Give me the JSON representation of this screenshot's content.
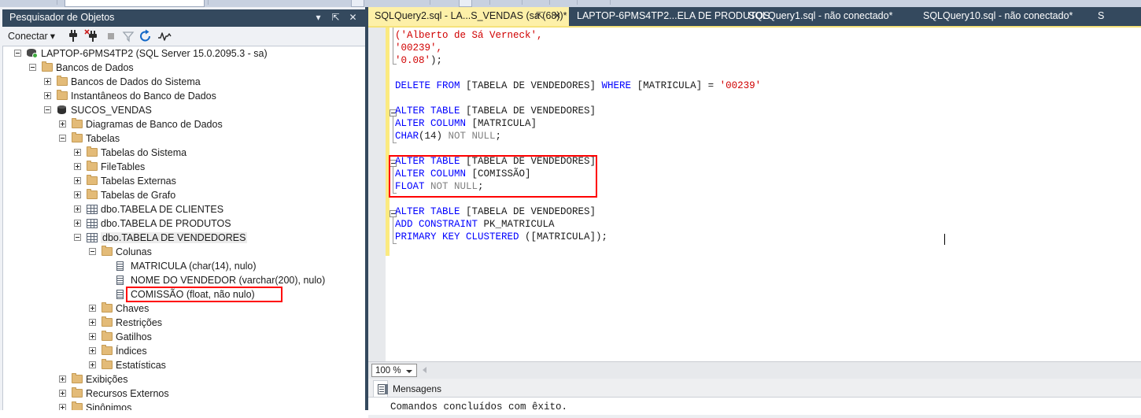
{
  "object_explorer": {
    "title": "Pesquisador de Objetos",
    "window_controls": {
      "dropdown": "▾",
      "pin": "⇱",
      "close": "✕"
    },
    "toolbar": {
      "connect_label": "Conectar",
      "connect_arrow": "▾",
      "icons": [
        "connect-plug-icon",
        "disconnect-plug-icon",
        "stop-icon",
        "filter-icon",
        "refresh-icon",
        "activity-monitor-icon"
      ]
    },
    "tree": [
      {
        "label": "LAPTOP-6PMS4TP2 (SQL Server 15.0.2095.3 - sa)",
        "depth": 0,
        "icon": "server-icon",
        "state": "expanded"
      },
      {
        "label": "Bancos de Dados",
        "depth": 1,
        "icon": "folder-icon",
        "state": "expanded"
      },
      {
        "label": "Bancos de Dados do Sistema",
        "depth": 2,
        "icon": "folder-icon",
        "state": "collapsed"
      },
      {
        "label": "Instantâneos do Banco de Dados",
        "depth": 2,
        "icon": "folder-icon",
        "state": "collapsed"
      },
      {
        "label": "SUCOS_VENDAS",
        "depth": 2,
        "icon": "database-icon",
        "state": "expanded"
      },
      {
        "label": "Diagramas de Banco de Dados",
        "depth": 3,
        "icon": "folder-icon",
        "state": "collapsed"
      },
      {
        "label": "Tabelas",
        "depth": 3,
        "icon": "folder-icon",
        "state": "expanded"
      },
      {
        "label": "Tabelas do Sistema",
        "depth": 4,
        "icon": "folder-icon",
        "state": "collapsed"
      },
      {
        "label": "FileTables",
        "depth": 4,
        "icon": "folder-icon",
        "state": "collapsed"
      },
      {
        "label": "Tabelas Externas",
        "depth": 4,
        "icon": "folder-icon",
        "state": "collapsed"
      },
      {
        "label": "Tabelas de Grafo",
        "depth": 4,
        "icon": "folder-icon",
        "state": "collapsed"
      },
      {
        "label": "dbo.TABELA DE CLIENTES",
        "depth": 4,
        "icon": "table-icon",
        "state": "collapsed"
      },
      {
        "label": "dbo.TABELA DE PRODUTOS",
        "depth": 4,
        "icon": "table-icon",
        "state": "collapsed"
      },
      {
        "label": "dbo.TABELA DE VENDEDORES",
        "depth": 4,
        "icon": "table-icon",
        "state": "expanded",
        "selected": true
      },
      {
        "label": "Colunas",
        "depth": 5,
        "icon": "folder-icon",
        "state": "expanded"
      },
      {
        "label": "MATRICULA (char(14), nulo)",
        "depth": 6,
        "icon": "column-icon",
        "state": "leaf"
      },
      {
        "label": "NOME DO VENDEDOR (varchar(200), nulo)",
        "depth": 6,
        "icon": "column-icon",
        "state": "leaf"
      },
      {
        "label": "COMISSÃO (float, não nulo)",
        "depth": 6,
        "icon": "column-icon",
        "state": "leaf",
        "highlighted": true
      },
      {
        "label": "Chaves",
        "depth": 5,
        "icon": "folder-icon",
        "state": "collapsed"
      },
      {
        "label": "Restrições",
        "depth": 5,
        "icon": "folder-icon",
        "state": "collapsed"
      },
      {
        "label": "Gatilhos",
        "depth": 5,
        "icon": "folder-icon",
        "state": "collapsed"
      },
      {
        "label": "Índices",
        "depth": 5,
        "icon": "folder-icon",
        "state": "collapsed"
      },
      {
        "label": "Estatísticas",
        "depth": 5,
        "icon": "folder-icon",
        "state": "collapsed"
      },
      {
        "label": "Exibições",
        "depth": 3,
        "icon": "folder-icon",
        "state": "collapsed"
      },
      {
        "label": "Recursos Externos",
        "depth": 3,
        "icon": "folder-icon",
        "state": "collapsed"
      },
      {
        "label": "Sinônimos",
        "depth": 3,
        "icon": "folder-icon",
        "state": "collapsed"
      }
    ]
  },
  "tabs": [
    {
      "label": "SQLQuery2.sql - LA...S_VENDAS (sa (68))*",
      "active": true,
      "pin": "⇱",
      "close": "✕"
    },
    {
      "label": "LAPTOP-6PMS4TP2...ELA DE PRODUTOS",
      "active": false
    },
    {
      "label": "SQLQuery1.sql - não conectado*",
      "active": false
    },
    {
      "label": "SQLQuery10.sql - não conectado*",
      "active": false
    },
    {
      "label": "S",
      "active": false
    }
  ],
  "code_lines": [
    [
      {
        "t": "('",
        "c": "str"
      },
      {
        "t": "Alberto de Sá Verneck",
        "c": "str"
      },
      {
        "t": "',",
        "c": "str"
      }
    ],
    [
      {
        "t": "'00239',",
        "c": "str"
      }
    ],
    [
      {
        "t": "'0.08'",
        "c": "str"
      },
      {
        "t": ");",
        "c": "plain"
      }
    ],
    [],
    [
      {
        "t": "DELETE FROM ",
        "c": "kw"
      },
      {
        "t": "[TABELA DE VENDEDORES] ",
        "c": "plain"
      },
      {
        "t": "WHERE ",
        "c": "kw"
      },
      {
        "t": "[MATRICULA] = ",
        "c": "plain"
      },
      {
        "t": "'00239'",
        "c": "str"
      }
    ],
    [],
    [
      {
        "t": "ALTER TABLE ",
        "c": "kw"
      },
      {
        "t": "[TABELA DE VENDEDORES]",
        "c": "plain"
      }
    ],
    [
      {
        "t": "ALTER COLUMN ",
        "c": "kw"
      },
      {
        "t": "[MATRICULA]",
        "c": "plain"
      }
    ],
    [
      {
        "t": "CHAR",
        "c": "kw"
      },
      {
        "t": "(14) ",
        "c": "plain"
      },
      {
        "t": "NOT NULL",
        "c": "gray"
      },
      {
        "t": ";",
        "c": "plain"
      }
    ],
    [],
    [
      {
        "t": "ALTER TABLE ",
        "c": "kw"
      },
      {
        "t": "[TABELA DE VENDEDORES]",
        "c": "plain"
      }
    ],
    [
      {
        "t": "ALTER COLUMN ",
        "c": "kw"
      },
      {
        "t": "[COMISSÃO]",
        "c": "plain"
      }
    ],
    [
      {
        "t": "FLOAT ",
        "c": "kw"
      },
      {
        "t": "NOT NULL",
        "c": "gray"
      },
      {
        "t": ";",
        "c": "plain"
      }
    ],
    [],
    [
      {
        "t": "ALTER TABLE ",
        "c": "kw"
      },
      {
        "t": "[TABELA DE VENDEDORES]",
        "c": "plain"
      }
    ],
    [
      {
        "t": "ADD CONSTRAINT ",
        "c": "kw"
      },
      {
        "t": "PK_MATRICULA",
        "c": "plain"
      }
    ],
    [
      {
        "t": "PRIMARY KEY CLUSTERED ",
        "c": "kw"
      },
      {
        "t": "([MATRICULA]);",
        "c": "plain"
      }
    ]
  ],
  "status_bar": {
    "zoom_value": "100 %",
    "zoom_arrow": "▾"
  },
  "results": {
    "tab_label": "Mensagens",
    "tab_icon": "messages-icon",
    "message": "Comandos concluídos com êxito."
  },
  "colors": {
    "chrome_dark": "#34495e",
    "active_tab": "#fdf0a8",
    "highlight_red": "#ff0000",
    "keyword_blue": "#0000ff",
    "string_red": "#d00000",
    "gray_keyword": "#808080",
    "change_bar_yellow": "#fbea80"
  }
}
